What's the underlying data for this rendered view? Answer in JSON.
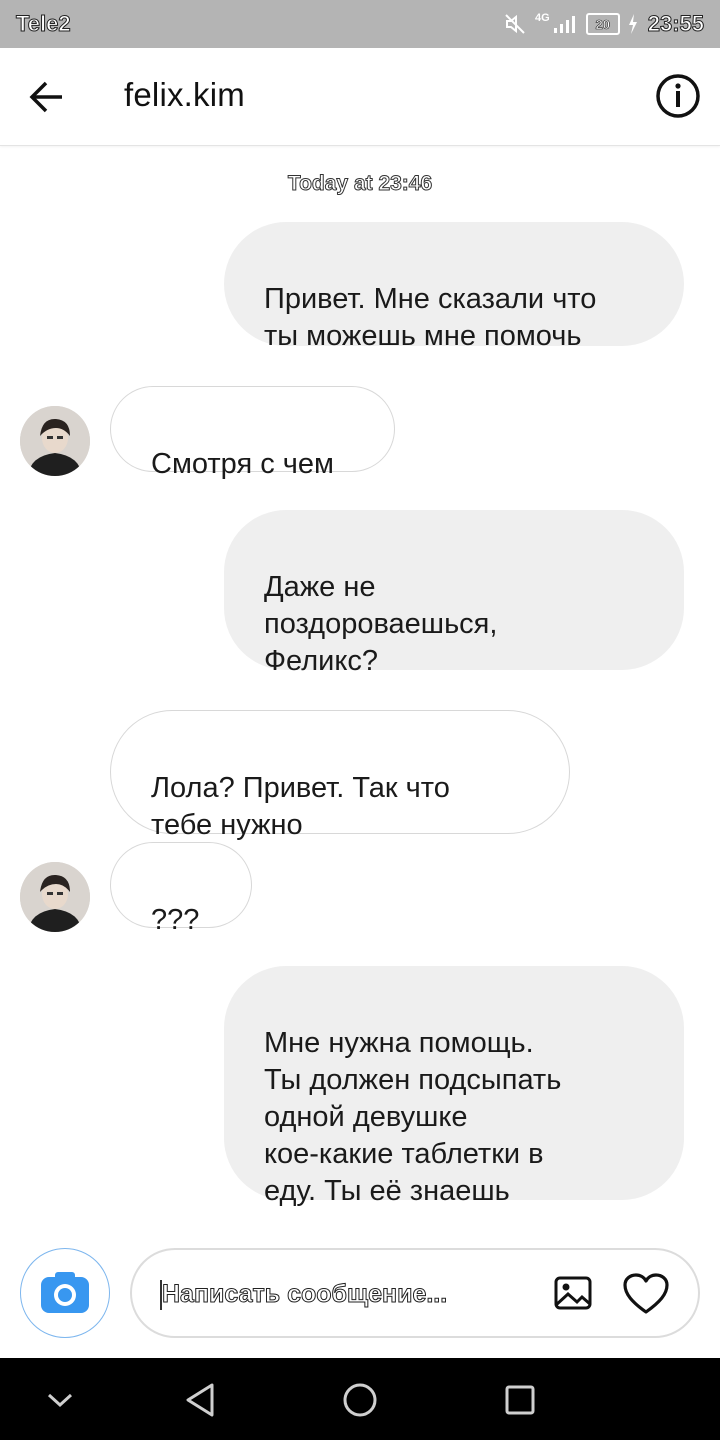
{
  "status_bar": {
    "carrier": "Tele2",
    "network": "4G",
    "battery": "20",
    "time": "23:55"
  },
  "header": {
    "title": "felix.kim",
    "back_icon": "arrow-left-icon",
    "info_icon": "info-icon"
  },
  "chat": {
    "timestamp": "Today at 23:46",
    "messages": [
      {
        "sender": "me",
        "text": "Привет. Мне сказали что\nты можешь мне помочь"
      },
      {
        "sender": "felix.kim",
        "text": "Смотря с чем"
      },
      {
        "sender": "me",
        "text": "Даже не\nпоздороваешься,\nФеликс?"
      },
      {
        "sender": "felix.kim",
        "text": "Лола? Привет. Так что\nтебе нужно"
      },
      {
        "sender": "felix.kim",
        "text": "???"
      },
      {
        "sender": "me",
        "text": "Мне нужна помощь.\nТы должен подсыпать\nодной девушке\nкое-какие таблетки в\nеду. Ты её знаешь"
      }
    ]
  },
  "composer": {
    "placeholder": "Написать сообщение...",
    "value": "",
    "camera_icon": "camera-icon",
    "gallery_icon": "image-icon",
    "like_icon": "heart-icon"
  },
  "nav_bar": {
    "buttons": [
      "chevron-down-icon",
      "back-triangle-icon",
      "home-circle-icon",
      "recents-square-icon"
    ]
  },
  "colors": {
    "status_bar": "#b4b4b4",
    "outgoing_bubble": "#efefef",
    "incoming_border": "#d8d8d8",
    "camera_accent": "#3897f0",
    "nav_bar": "#000000"
  }
}
